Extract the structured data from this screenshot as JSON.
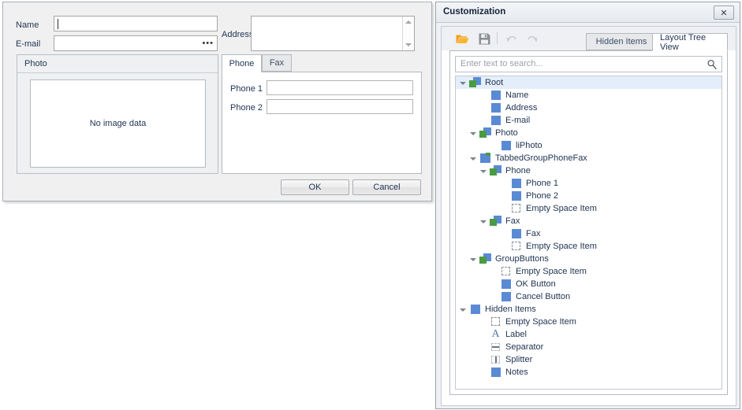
{
  "form": {
    "fields": {
      "name_label": "Name",
      "name_value": "",
      "email_label": "E-mail",
      "email_value": "",
      "email_button_glyph": "•••",
      "address_label": "Address",
      "address_value": ""
    },
    "photo_group": {
      "caption": "Photo",
      "empty_text": "No image data"
    },
    "tabs": [
      {
        "label": "Phone",
        "active": true
      },
      {
        "label": "Fax",
        "active": false
      }
    ],
    "phone_tab": {
      "phone1_label": "Phone 1",
      "phone1_value": "",
      "phone2_label": "Phone 2",
      "phone2_value": ""
    },
    "buttons": {
      "ok": "OK",
      "cancel": "Cancel"
    }
  },
  "customization": {
    "title": "Customization",
    "close_glyph": "✕",
    "toolbar": {
      "open_title": "Open",
      "save_title": "Save",
      "undo_title": "Undo",
      "redo_title": "Redo"
    },
    "tabs": [
      {
        "label": "Hidden Items",
        "active": false
      },
      {
        "label": "Layout Tree View",
        "active": true
      }
    ],
    "search": {
      "placeholder": "Enter text to search...",
      "value": ""
    },
    "tree": [
      {
        "label": "Root",
        "depth": 0,
        "icon": "group",
        "expander": true,
        "selected": true
      },
      {
        "label": "Name",
        "depth": 2,
        "icon": "item",
        "expander": false,
        "selected": false
      },
      {
        "label": "Address",
        "depth": 2,
        "icon": "item",
        "expander": false,
        "selected": false
      },
      {
        "label": "E-mail",
        "depth": 2,
        "icon": "item",
        "expander": false,
        "selected": false
      },
      {
        "label": "Photo",
        "depth": 1,
        "icon": "group",
        "expander": true,
        "selected": false
      },
      {
        "label": "liPhoto",
        "depth": 3,
        "icon": "item",
        "expander": false,
        "selected": false
      },
      {
        "label": "TabbedGroupPhoneFax",
        "depth": 1,
        "icon": "tabgroup",
        "expander": true,
        "selected": false
      },
      {
        "label": "Phone",
        "depth": 2,
        "icon": "group",
        "expander": true,
        "selected": false
      },
      {
        "label": "Phone 1",
        "depth": 4,
        "icon": "item",
        "expander": false,
        "selected": false
      },
      {
        "label": "Phone 2",
        "depth": 4,
        "icon": "item",
        "expander": false,
        "selected": false
      },
      {
        "label": "Empty Space Item",
        "depth": 4,
        "icon": "empty",
        "expander": false,
        "selected": false
      },
      {
        "label": "Fax",
        "depth": 2,
        "icon": "group",
        "expander": true,
        "selected": false
      },
      {
        "label": "Fax",
        "depth": 4,
        "icon": "item",
        "expander": false,
        "selected": false
      },
      {
        "label": "Empty Space Item",
        "depth": 4,
        "icon": "empty",
        "expander": false,
        "selected": false
      },
      {
        "label": "GroupButtons",
        "depth": 1,
        "icon": "group",
        "expander": true,
        "selected": false
      },
      {
        "label": "Empty Space Item",
        "depth": 3,
        "icon": "empty",
        "expander": false,
        "selected": false
      },
      {
        "label": "OK Button",
        "depth": 3,
        "icon": "item",
        "expander": false,
        "selected": false
      },
      {
        "label": "Cancel Button",
        "depth": 3,
        "icon": "item",
        "expander": false,
        "selected": false
      },
      {
        "label": "Hidden Items",
        "depth": 0,
        "icon": "item",
        "expander": true,
        "selected": false
      },
      {
        "label": "Empty Space Item",
        "depth": 2,
        "icon": "empty",
        "expander": false,
        "selected": false
      },
      {
        "label": "Label",
        "depth": 2,
        "icon": "labelicon",
        "expander": false,
        "selected": false
      },
      {
        "label": "Separator",
        "depth": 2,
        "icon": "separator",
        "expander": false,
        "selected": false
      },
      {
        "label": "Splitter",
        "depth": 2,
        "icon": "splitter",
        "expander": false,
        "selected": false
      },
      {
        "label": "Notes",
        "depth": 2,
        "icon": "item",
        "expander": false,
        "selected": false
      }
    ]
  },
  "colors": {
    "accent_blue": "#5b8ad4",
    "accent_green": "#4a9b43",
    "folder_orange": "#f5a623",
    "selection": "#e4eefb",
    "panel_bg": "#eef0f3",
    "text": "#1f3350"
  }
}
